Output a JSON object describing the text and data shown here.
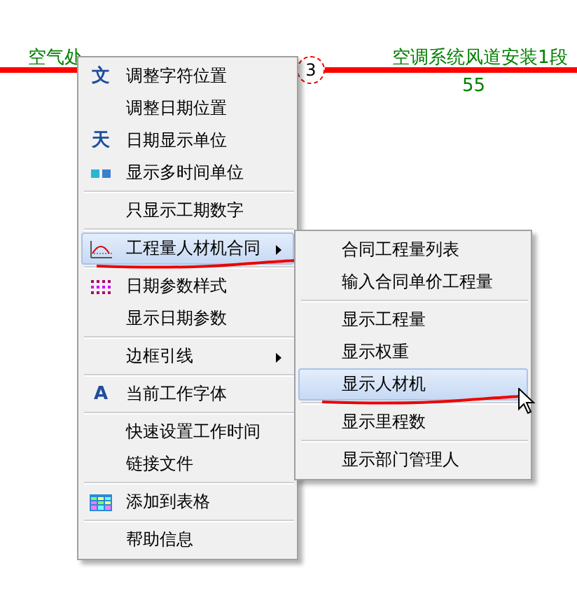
{
  "chart": {
    "left_task": {
      "label": "空气处"
    },
    "node": {
      "label": "3"
    },
    "right_task": {
      "label": "空调系统风道安装1段",
      "duration": "55"
    }
  },
  "main_menu": {
    "items": [
      {
        "kind": "glyph",
        "label": "调整字符位置",
        "icon_text": "文",
        "selected": false,
        "submenu": false,
        "underlined": false
      },
      {
        "kind": "text",
        "label": "调整日期位置",
        "selected": false,
        "submenu": false,
        "underlined": false
      },
      {
        "kind": "glyph",
        "label": "日期显示单位",
        "icon_text": "天",
        "selected": false,
        "submenu": false,
        "underlined": false
      },
      {
        "kind": "multi",
        "label": "显示多时间单位",
        "selected": false,
        "submenu": false,
        "underlined": false
      },
      {
        "kind": "separator"
      },
      {
        "kind": "text",
        "label": "只显示工期数字",
        "selected": false,
        "submenu": false,
        "underlined": false
      },
      {
        "kind": "separator"
      },
      {
        "kind": "chart",
        "label": "工程量人材机合同",
        "selected": true,
        "submenu": true,
        "underlined": true
      },
      {
        "kind": "separator"
      },
      {
        "kind": "dots",
        "label": "日期参数样式",
        "selected": false,
        "submenu": false,
        "underlined": false
      },
      {
        "kind": "text",
        "label": "显示日期参数",
        "selected": false,
        "submenu": false,
        "underlined": false
      },
      {
        "kind": "separator"
      },
      {
        "kind": "text",
        "label": "边框引线",
        "selected": false,
        "submenu": true,
        "underlined": false
      },
      {
        "kind": "separator"
      },
      {
        "kind": "glyph",
        "label": "当前工作字体",
        "icon_text": "A",
        "selected": false,
        "submenu": false,
        "underlined": false
      },
      {
        "kind": "separator"
      },
      {
        "kind": "text",
        "label": "快速设置工作时间",
        "selected": false,
        "submenu": false,
        "underlined": false
      },
      {
        "kind": "text",
        "label": "链接文件",
        "selected": false,
        "submenu": false,
        "underlined": false
      },
      {
        "kind": "separator"
      },
      {
        "kind": "table",
        "label": "添加到表格",
        "selected": false,
        "submenu": false,
        "underlined": false
      },
      {
        "kind": "separator"
      },
      {
        "kind": "text",
        "label": "帮助信息",
        "selected": false,
        "submenu": false,
        "underlined": false
      }
    ]
  },
  "submenu": {
    "items": [
      {
        "kind": "text",
        "label": "合同工程量列表",
        "selected": false,
        "underlined": false
      },
      {
        "kind": "text",
        "label": "输入合同单价工程量",
        "selected": false,
        "underlined": false
      },
      {
        "kind": "separator"
      },
      {
        "kind": "text",
        "label": "显示工程量",
        "selected": false,
        "underlined": false
      },
      {
        "kind": "text",
        "label": "显示权重",
        "selected": false,
        "underlined": false
      },
      {
        "kind": "text",
        "label": "显示人材机",
        "selected": true,
        "underlined": true
      },
      {
        "kind": "separator"
      },
      {
        "kind": "text",
        "label": "显示里程数",
        "selected": false,
        "underlined": false
      },
      {
        "kind": "separator"
      },
      {
        "kind": "text",
        "label": "显示部门管理人",
        "selected": false,
        "underlined": false
      }
    ]
  }
}
